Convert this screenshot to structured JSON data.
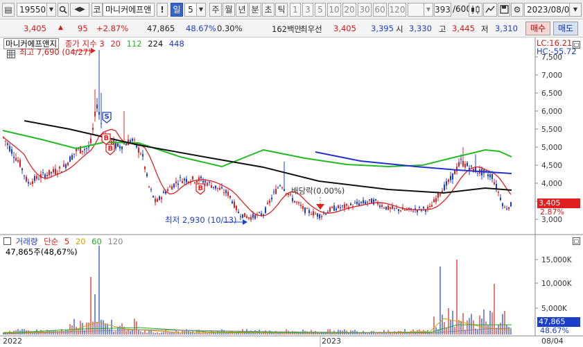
{
  "toolbar": {
    "stock_code": "195500",
    "market_tab": "코",
    "stock_name": "마니커에프앤",
    "alert_label": "!",
    "period_selected": "일",
    "period_value": "5",
    "periods": [
      "주",
      "월",
      "년",
      "분",
      "초",
      "틱"
    ],
    "minute_values": [
      "1",
      "3",
      "5",
      "10",
      "20",
      "30",
      "60",
      "120"
    ],
    "count_display": "393",
    "count_total": "/600",
    "date": "2023/08/04"
  },
  "infobar": {
    "price": "3,405",
    "change": "95",
    "change_rate": "+2.87%",
    "volume": "47,865",
    "volume_rate": "48.67%",
    "turnover": "0.30%",
    "amount": "162백만",
    "priority_label": "최우선",
    "best_ask": "3,405",
    "best_bid": "3,395",
    "open_label": "시",
    "open": "3,330",
    "high_label": "고",
    "high": "3,445",
    "low_label": "저",
    "low": "3,310",
    "buy_label": "매수",
    "sell_label": "매도"
  },
  "price_panel": {
    "stock_tag": "마니커에프앤지",
    "indicator_name": "종가 지수 3",
    "ma_periods": [
      "20",
      "112",
      "224",
      "448"
    ],
    "ma_colors": [
      "#e02020",
      "#22bb22",
      "#111111",
      "#2233cc"
    ],
    "lc": "LC:16.21",
    "hc": "HC:-55.72",
    "high_annotation": "최고 7,690 (04/27)",
    "low_annotation": "최저 2,930 (10/13)",
    "dividend_annotation": "배당락(0.00%)",
    "last_price": "3,405",
    "last_change": "2.87%",
    "y_labels": [
      "7,500",
      "7,000",
      "6,500",
      "6,000",
      "5,500",
      "5,000",
      "4,500",
      "4,000",
      "3,500",
      "3,000"
    ],
    "signals": [
      "S",
      "B",
      "B",
      "B"
    ]
  },
  "volume_panel": {
    "title": "거래량",
    "ma_label": "단순",
    "ma_periods": [
      "5",
      "20",
      "60",
      "120"
    ],
    "ma_colors": [
      "#e02020",
      "#d8a000",
      "#22aa22",
      "#888888"
    ],
    "summary": "47,865주(48,67%)",
    "y_labels": [
      "15,000K",
      "10,000K",
      "5,000K"
    ],
    "last_volume": "47,865",
    "last_rate": "48.67%"
  },
  "x_axis": {
    "labels": [
      "2022",
      "2023"
    ],
    "right_label": "08/04"
  }
}
